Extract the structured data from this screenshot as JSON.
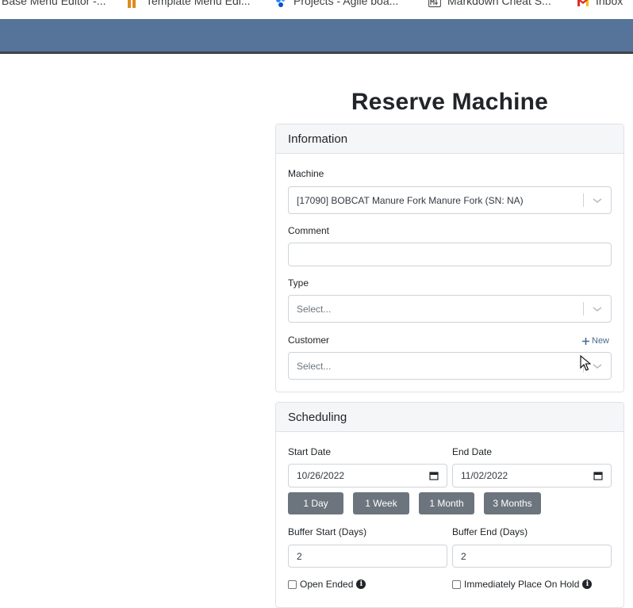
{
  "bookmarks": [
    {
      "label": "Base Menu Editor -...",
      "icon": "page-icon"
    },
    {
      "label": "Template Menu Edi...",
      "icon": "template-logo-icon"
    },
    {
      "label": "Projects - Agile boa...",
      "icon": "jira-icon"
    },
    {
      "label": "Markdown Cheat S...",
      "icon": "markdown-icon"
    },
    {
      "label": "Inbox",
      "icon": "gmail-icon"
    }
  ],
  "page": {
    "title": "Reserve Machine"
  },
  "information": {
    "header": "Information",
    "machine_label": "Machine",
    "machine_value": "[17090] BOBCAT Manure Fork Manure Fork (SN: NA)",
    "comment_label": "Comment",
    "comment_value": "",
    "type_label": "Type",
    "type_placeholder": "Select...",
    "customer_label": "Customer",
    "customer_new": "New",
    "customer_placeholder": "Select..."
  },
  "scheduling": {
    "header": "Scheduling",
    "start_label": "Start Date",
    "start_value": "10/26/2022",
    "end_label": "End Date",
    "end_value": "11/02/2022",
    "quick_buttons": [
      "1 Day",
      "1 Week",
      "1 Month",
      "3 Months"
    ],
    "buffer_start_label": "Buffer Start (Days)",
    "buffer_start_value": "2",
    "buffer_end_label": "Buffer End (Days)",
    "buffer_end_value": "2",
    "open_ended_label": "Open Ended",
    "hold_label": "Immediately Place On Hold"
  },
  "colors": {
    "header_band": "#56749a",
    "button": "#6c757d",
    "accent_link": "#4a6a8f"
  }
}
